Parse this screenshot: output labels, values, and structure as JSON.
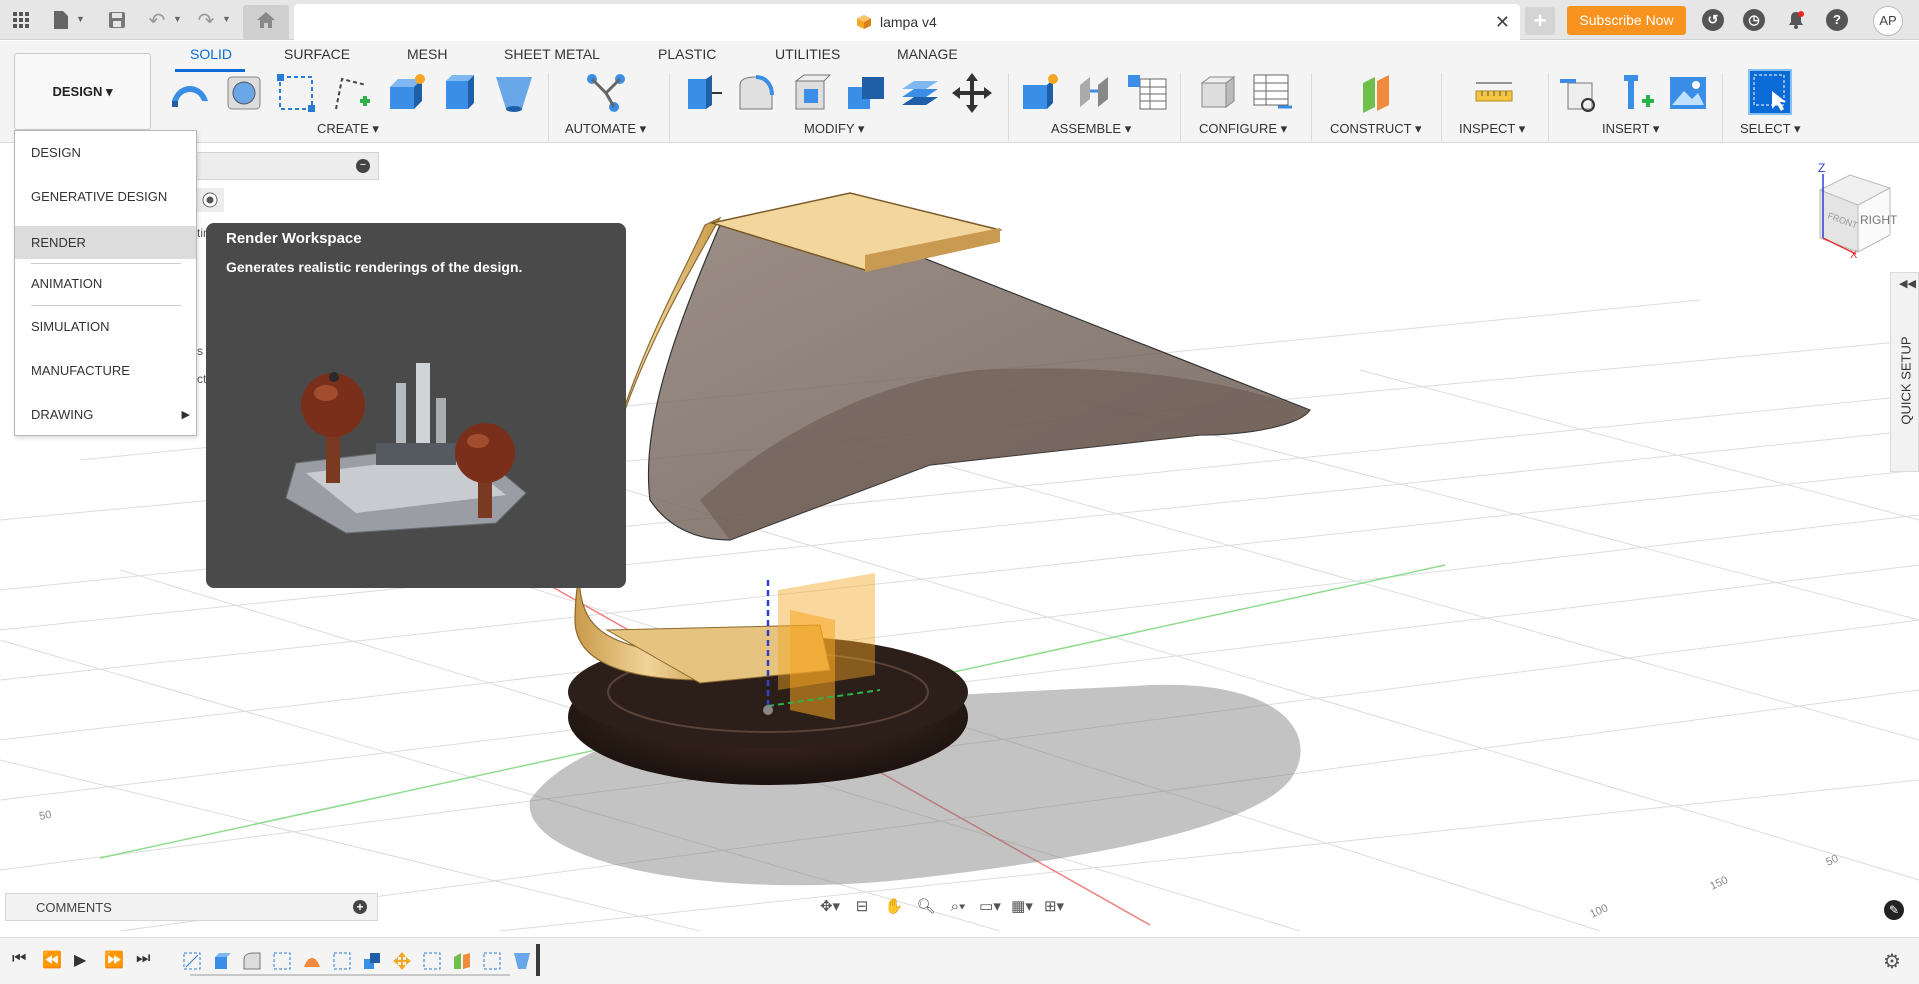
{
  "titlebar": {
    "document_title": "lampa v4",
    "subscribe_label": "Subscribe Now",
    "user_initials": "AP",
    "icons": [
      "apps-grid-icon",
      "file-icon",
      "save-icon",
      "undo-icon",
      "redo-icon",
      "home-icon",
      "close-icon",
      "new-tab-icon",
      "extensions-icon",
      "job-status-icon",
      "notifications-icon",
      "help-icon"
    ]
  },
  "workspace_button": {
    "label": "DESIGN ▾"
  },
  "tabs": [
    {
      "label": "SOLID",
      "active": true
    },
    {
      "label": "SURFACE"
    },
    {
      "label": "MESH"
    },
    {
      "label": "SHEET METAL"
    },
    {
      "label": "PLASTIC"
    },
    {
      "label": "UTILITIES"
    },
    {
      "label": "MANAGE"
    }
  ],
  "tool_groups": [
    {
      "label": "CREATE ▾"
    },
    {
      "label": "AUTOMATE ▾"
    },
    {
      "label": "MODIFY ▾"
    },
    {
      "label": "ASSEMBLE ▾"
    },
    {
      "label": "CONFIGURE ▾"
    },
    {
      "label": "CONSTRUCT ▾"
    },
    {
      "label": "INSPECT ▾"
    },
    {
      "label": "INSERT ▾"
    },
    {
      "label": "SELECT ▾"
    }
  ],
  "workspace_menu": {
    "items": [
      {
        "label": "DESIGN"
      },
      {
        "label": "GENERATIVE DESIGN"
      },
      {
        "label": "RENDER",
        "highlighted": true
      },
      {
        "label": "ANIMATION"
      },
      {
        "label": "SIMULATION"
      },
      {
        "label": "MANUFACTURE"
      },
      {
        "label": "DRAWING",
        "has_submenu": true
      }
    ]
  },
  "tooltip": {
    "title": "Render Workspace",
    "description": "Generates realistic renderings of the design."
  },
  "viewcube": {
    "label_right": "RIGHT",
    "label_front": "FRONT",
    "axis_z": "Z",
    "axis_x": "X"
  },
  "quick_setup": {
    "label": "QUICK SETUP"
  },
  "comments": {
    "label": "COMMENTS"
  },
  "browser_peek": {
    "fragments": [
      "tin",
      "s",
      "cti"
    ]
  },
  "grid_labels": [
    "50",
    "100",
    "150",
    "50"
  ],
  "colors": {
    "accent": "#0a6ad6",
    "subscribe": "#f7931e",
    "tooltip_bg": "#4a4a4a",
    "lamp_wood": "#e8c27a",
    "lamp_base": "#2a1d17",
    "lamp_shade": "#7a6a60"
  }
}
